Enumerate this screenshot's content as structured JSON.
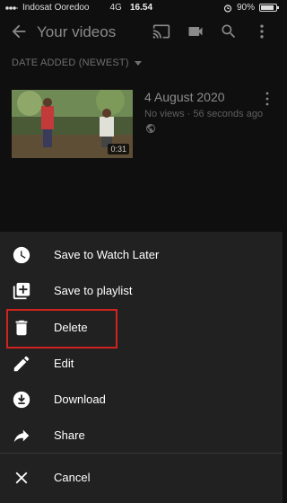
{
  "status": {
    "carrier": "Indosat Ooredoo",
    "network": "4G",
    "time": "16.54",
    "battery_text": "90%",
    "battery_level": 0.9
  },
  "appbar": {
    "title": "Your videos",
    "icons": [
      "back-arrow-icon",
      "cast-icon",
      "video-camera-icon",
      "search-icon",
      "more-vert-icon"
    ]
  },
  "sort": {
    "label": "DATE ADDED (NEWEST)"
  },
  "video": {
    "title": "4 August 2020",
    "meta": "No views · 56 seconds ago",
    "duration": "0:31",
    "visibility_icon": "globe-icon"
  },
  "menu": {
    "items": [
      {
        "label": "Save to Watch Later",
        "icon": "clock-icon"
      },
      {
        "label": "Save to playlist",
        "icon": "playlist-add-icon"
      },
      {
        "label": "Delete",
        "icon": "trash-icon"
      },
      {
        "label": "Edit",
        "icon": "pencil-icon"
      },
      {
        "label": "Download",
        "icon": "download-icon"
      },
      {
        "label": "Share",
        "icon": "share-icon"
      }
    ],
    "cancel": {
      "label": "Cancel",
      "icon": "close-icon"
    }
  },
  "colors": {
    "sheet_bg": "#212121",
    "page_bg": "#0f0f0f",
    "highlight": "#d0231f"
  }
}
